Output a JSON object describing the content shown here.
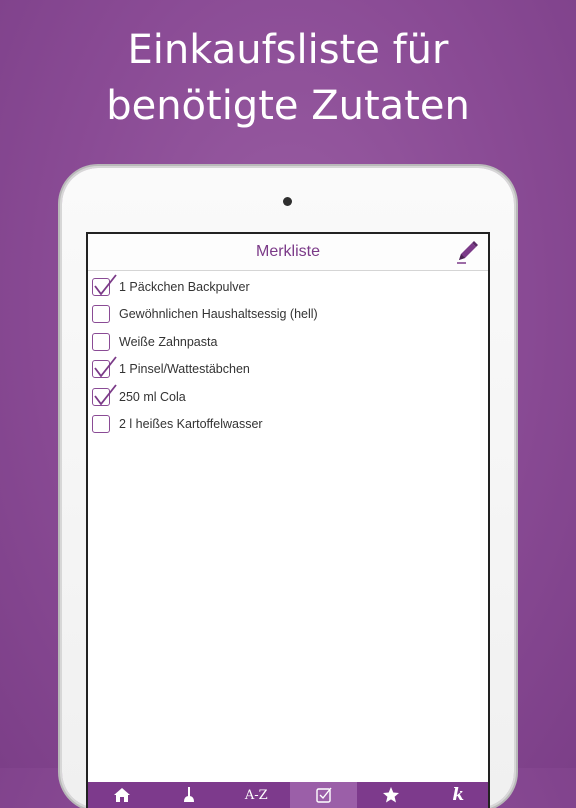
{
  "promo": {
    "line1": "Einkaufsliste für",
    "line2": "benötigte Zutaten"
  },
  "app": {
    "title": "Merkliste",
    "edit_icon": "pencil-icon",
    "accent_color": "#7b3a88",
    "items": [
      {
        "label": "1 Päckchen Backpulver",
        "checked": true
      },
      {
        "label": "Gewöhnlichen Haushaltsessig (hell)",
        "checked": false
      },
      {
        "label": "Weiße Zahnpasta",
        "checked": false
      },
      {
        "label": "1 Pinsel/Wattestäbchen",
        "checked": true
      },
      {
        "label": "250 ml Cola",
        "checked": true
      },
      {
        "label": "2 l heißes Kartoffelwasser",
        "checked": false
      }
    ],
    "tabs": [
      {
        "icon": "home-icon"
      },
      {
        "icon": "plunger-icon"
      },
      {
        "icon": "az-icon",
        "label": "A-Z"
      },
      {
        "icon": "checkbox-icon",
        "active": true
      },
      {
        "icon": "star-icon"
      },
      {
        "icon": "k-logo-icon",
        "label": "k"
      }
    ]
  }
}
